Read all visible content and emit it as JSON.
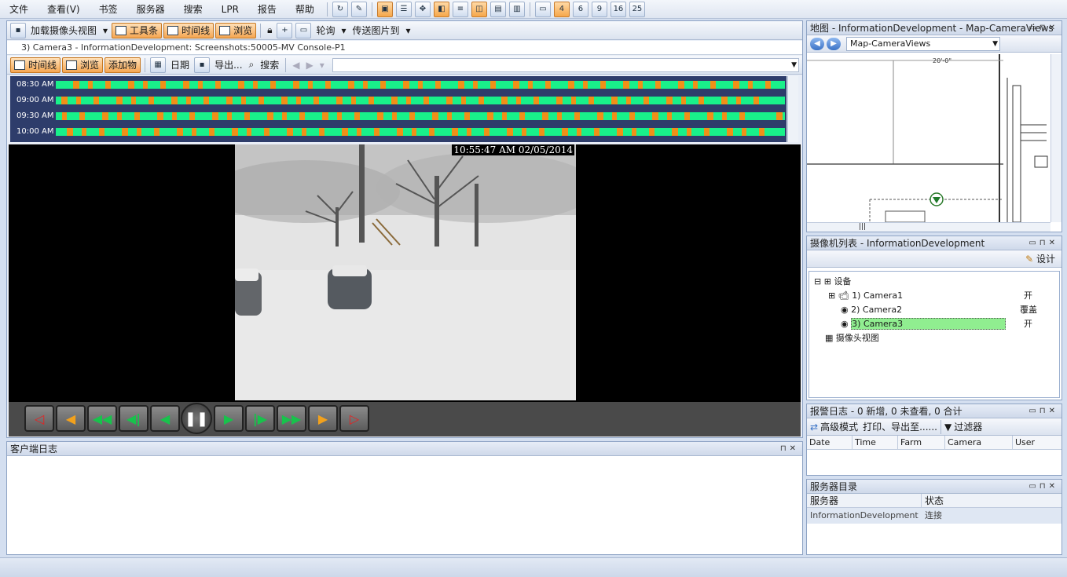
{
  "menu": [
    "文件",
    "查看(V)",
    "书签",
    "服务器",
    "搜索",
    "LPR",
    "报告",
    "帮助"
  ],
  "toolbar": {
    "load_view": "加载摄像头视图",
    "toolbox": "工具条",
    "timeline": "时间线",
    "browse": "浏览",
    "patrol": "轮询",
    "send_image": "传送图片到"
  },
  "camera": {
    "title": "3) Camera3 - InformationDevelopment: Screenshots:50005-MV Console-P1",
    "tb_timeline": "时间线",
    "tb_browse": "浏览",
    "tb_add": "添加物",
    "tb_date": "日期",
    "tb_export": "导出...",
    "tb_search": "搜索",
    "timeline_rows": [
      "08:30 AM",
      "09:00 AM",
      "09:30 AM",
      "10:00 AM"
    ],
    "timestamp": "10:55:47 AM 02/05/2014"
  },
  "client_log": {
    "title": "客户端日志"
  },
  "map": {
    "title": "地图 - InformationDevelopment - Map-CameraViews",
    "selected": "Map-CameraViews",
    "scale_label": "20'-0\"",
    "hscroll": "|||"
  },
  "camera_list": {
    "title": "摄像机列表 - InformationDevelopment",
    "design": "设计",
    "root": "设备",
    "cameras": [
      {
        "name": "1) Camera1",
        "status": "开"
      },
      {
        "name": "2) Camera2",
        "status": "覆盖"
      },
      {
        "name": "3) Camera3",
        "status": "开"
      }
    ],
    "views": "摄像头视图"
  },
  "alarm_log": {
    "title": "报警日志 - 0 新增, 0 未查看, 0 合计",
    "advanced": "高级模式",
    "print": "打印、导出至......",
    "filter": "过滤器",
    "columns": [
      "Date",
      "Time",
      "Farm",
      "Camera",
      "User"
    ]
  },
  "server_dir": {
    "title": "服务器目录",
    "col_server": "服务器",
    "col_status": "状态",
    "rows": [
      {
        "server": "InformationDevelopment",
        "status": "连接"
      }
    ]
  },
  "colors": {
    "timeline_green": "#19f08a",
    "timeline_orange": "#f09018",
    "toggle_orange": "#f5a652",
    "selected_camera": "#90ee90"
  }
}
